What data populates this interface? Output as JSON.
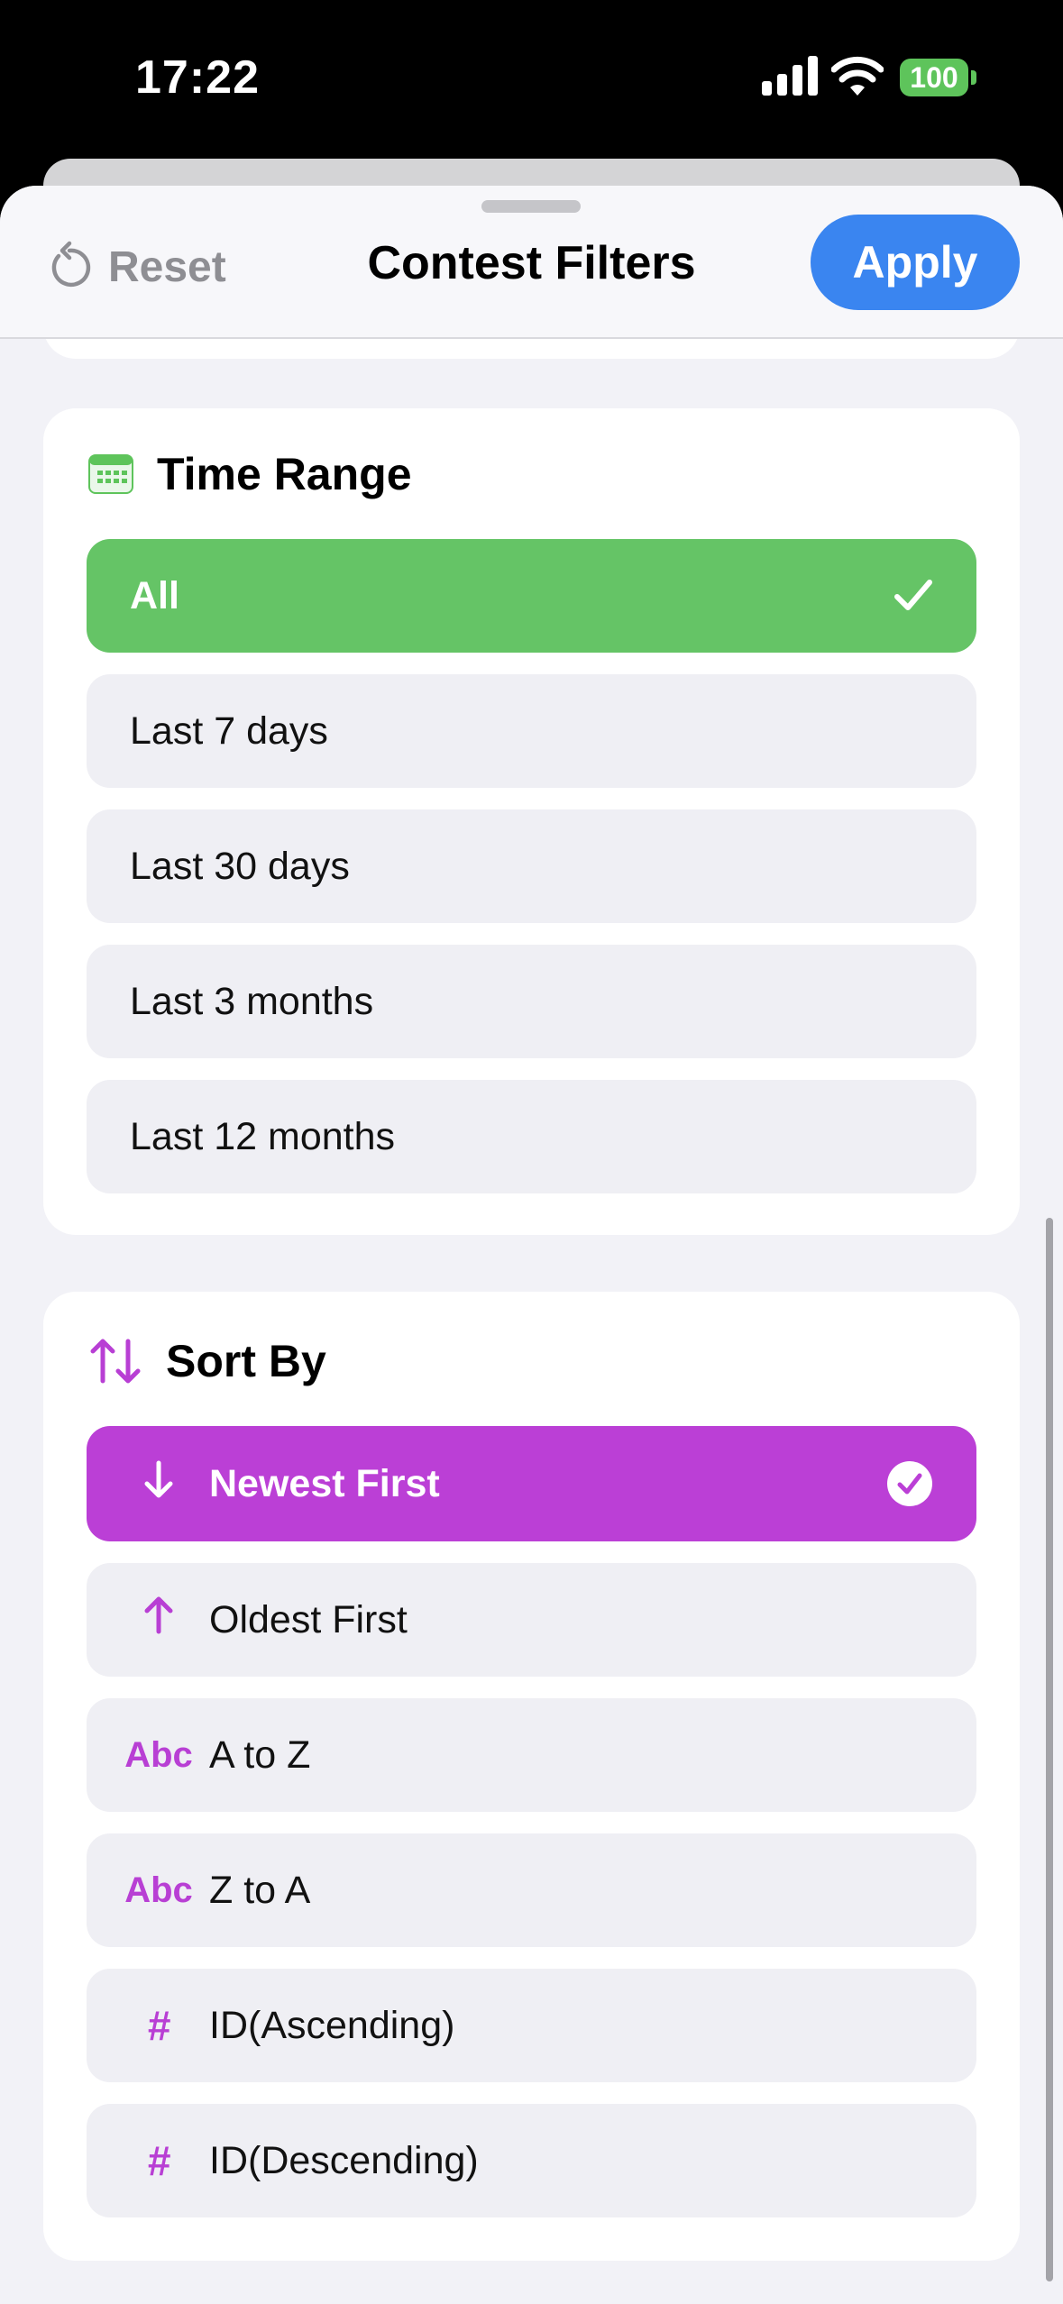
{
  "status_bar": {
    "time": "17:22",
    "battery": "100"
  },
  "header": {
    "reset_label": "Reset",
    "title": "Contest Filters",
    "apply_label": "Apply"
  },
  "time_range": {
    "title": "Time Range",
    "options": [
      "All",
      "Last 7 days",
      "Last 30 days",
      "Last 3 months",
      "Last 12 months"
    ],
    "selected": "All"
  },
  "sort_by": {
    "title": "Sort By",
    "options": [
      {
        "icon": "arrow-down-icon",
        "icon_text": "",
        "label": "Newest First"
      },
      {
        "icon": "arrow-up-icon",
        "icon_text": "",
        "label": "Oldest First"
      },
      {
        "icon": "abc-icon",
        "icon_text": "Abc",
        "label": "A to Z"
      },
      {
        "icon": "abc-icon",
        "icon_text": "Abc",
        "label": "Z to A"
      },
      {
        "icon": "hash-icon",
        "icon_text": "#",
        "label": "ID(Ascending)"
      },
      {
        "icon": "hash-icon",
        "icon_text": "#",
        "label": "ID(Descending)"
      }
    ],
    "selected": "Newest First"
  },
  "colors": {
    "accent_blue": "#3a85f0",
    "time_selected": "#65c466",
    "sort_selected": "#bb3fd6",
    "option_bg": "#efeff4"
  }
}
